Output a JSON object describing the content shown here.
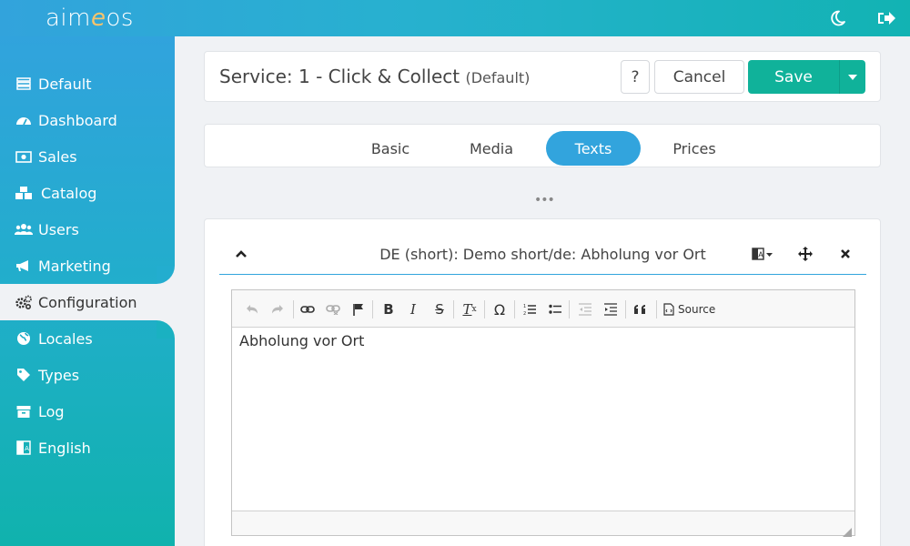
{
  "app": {
    "logo_pre": "aim",
    "logo_e": "e",
    "logo_post": "os"
  },
  "topbar": {
    "theme_icon": "moon-icon",
    "logout_icon": "logout-icon"
  },
  "sidebar": {
    "items": [
      {
        "label": "Default",
        "icon": "server-icon"
      },
      {
        "label": "Dashboard",
        "icon": "dashboard-icon"
      },
      {
        "label": "Sales",
        "icon": "money-icon"
      },
      {
        "label": "Catalog",
        "icon": "cubes-icon"
      },
      {
        "label": "Users",
        "icon": "users-icon"
      },
      {
        "label": "Marketing",
        "icon": "bullhorn-icon"
      },
      {
        "label": "Configuration",
        "icon": "gears-icon"
      },
      {
        "label": "Locales",
        "icon": "globe-icon"
      },
      {
        "label": "Types",
        "icon": "tag-icon"
      },
      {
        "label": "Log",
        "icon": "archive-icon"
      },
      {
        "label": "English",
        "icon": "language-icon"
      }
    ],
    "active_index": 6
  },
  "header": {
    "title": "Service: 1 - Click & Collect",
    "site": "(Default)",
    "help_label": "?",
    "cancel_label": "Cancel",
    "save_label": "Save"
  },
  "tabs": [
    {
      "label": "Basic"
    },
    {
      "label": "Media"
    },
    {
      "label": "Texts",
      "active": true
    },
    {
      "label": "Prices"
    }
  ],
  "more_label": "•••",
  "text_item": {
    "title": "DE (short): Demo short/de: Abholung vor Ort",
    "content": "Abholung vor Ort",
    "source_label": "Source"
  },
  "colors": {
    "accent": "#32a4dd",
    "save": "#10b29a",
    "sidebar_top": "#31a3dd",
    "sidebar_bottom": "#10b2ad"
  }
}
